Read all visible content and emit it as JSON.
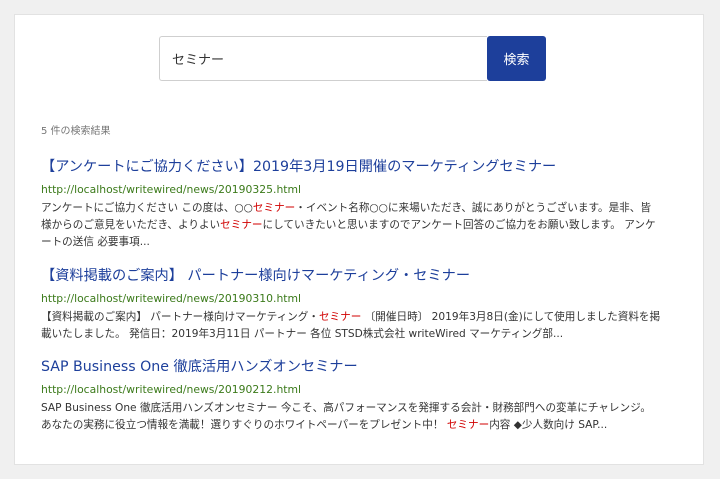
{
  "search": {
    "value": "セミナー",
    "button_label": "検索"
  },
  "result_count": "5 件の検索結果",
  "results": [
    {
      "title": "【アンケートにご協力ください】2019年3月19日開催のマーケティングセミナー",
      "url": "http://localhost/writewired/news/20190325.html",
      "snippet": [
        {
          "text": "アンケートにご協力ください この度は、○○"
        },
        {
          "text": "セミナー",
          "hl": true
        },
        {
          "text": "・イベント名称○○に来場いただき、誠にありがとうございます。是非、皆様からのご意見をいただき、よりよい"
        },
        {
          "text": "セミナー",
          "hl": true
        },
        {
          "text": "にしていきたいと思いますのでアンケート回答のご協力をお願い致します。 アンケートの送信 必要事項..."
        }
      ]
    },
    {
      "title": "【資料掲載のご案内】 パートナー様向けマーケティング・セミナー",
      "url": "http://localhost/writewired/news/20190310.html",
      "snippet": [
        {
          "text": "【資料掲載のご案内】 パートナー様向けマーケティング・"
        },
        {
          "text": "セミナー",
          "hl": true
        },
        {
          "text": " 〔開催日時〕 2019年3月8日(金)にして使用しました資料を掲載いたしました。 発信日：2019年3月11日 パートナー 各位 STSD株式会社 writeWired マーケティング部..."
        }
      ]
    },
    {
      "title": "SAP Business One 徹底活用ハンズオンセミナー",
      "url": "http://localhost/writewired/news/20190212.html",
      "snippet": [
        {
          "text": "SAP Business One 徹底活用ハンズオンセミナー 今こそ、高パフォーマンスを発揮する会計・財務部門への変革にチャレンジ。あなたの実務に役立つ情報を満載！選りすぐりのホワイトペーパーをプレゼント中！ "
        },
        {
          "text": "セミナー",
          "hl": true
        },
        {
          "text": "内容 ◆少人数向け SAP..."
        }
      ]
    }
  ]
}
